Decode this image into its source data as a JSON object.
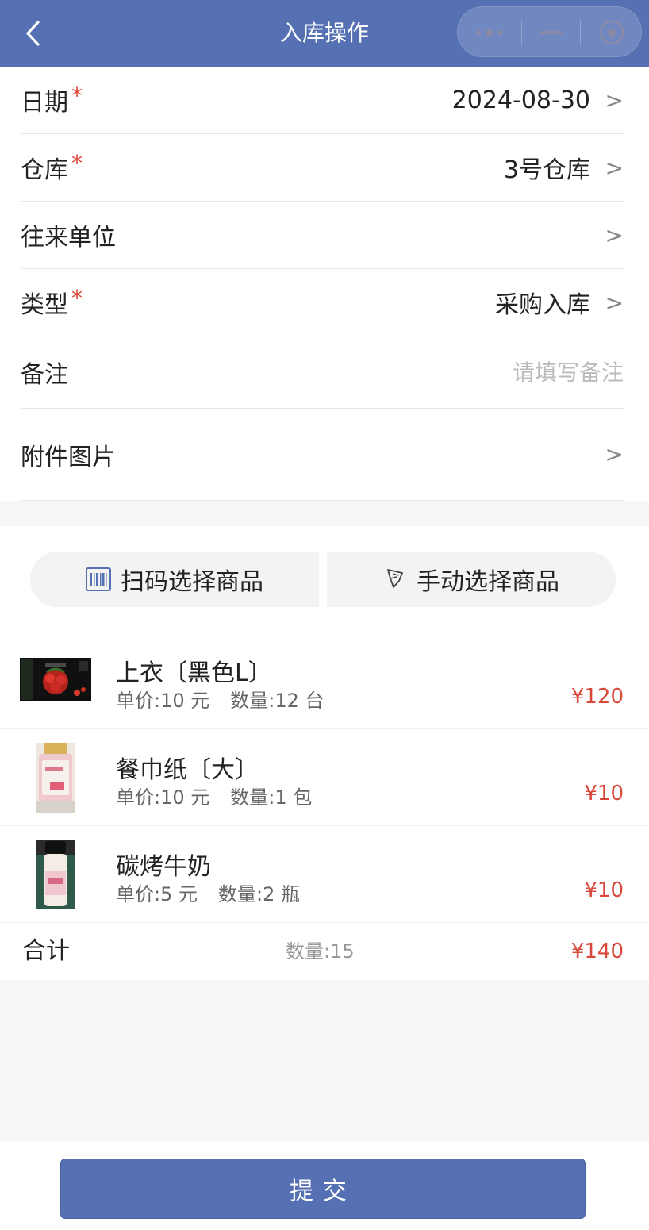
{
  "nav": {
    "title": "入库操作"
  },
  "form": {
    "date": {
      "label": "日期",
      "required": "*",
      "value": "2024-08-30",
      "arrow": ">"
    },
    "warehouse": {
      "label": "仓库",
      "required": "*",
      "value": "3号仓库",
      "arrow": ">"
    },
    "partner": {
      "label": "往来单位",
      "value": "",
      "arrow": ">"
    },
    "type": {
      "label": "类型",
      "required": "*",
      "value": "采购入库",
      "arrow": ">"
    },
    "remark": {
      "label": "备注",
      "value": "",
      "placeholder": "请填写备注"
    },
    "attachment": {
      "label": "附件图片",
      "arrow": ">"
    }
  },
  "actions": {
    "scan_label": "扫码选择商品",
    "manual_label": "手动选择商品"
  },
  "items": [
    {
      "name": "上衣〔黑色L〕",
      "unit_price": "单价:10 元",
      "quantity": "数量:12 台",
      "amount": "¥120"
    },
    {
      "name": "餐巾纸〔大〕",
      "unit_price": "单价:10 元",
      "quantity": "数量:1 包",
      "amount": "¥10"
    },
    {
      "name": "碳烤牛奶",
      "unit_price": "单价:5 元",
      "quantity": "数量:2 瓶",
      "amount": "¥10"
    }
  ],
  "total": {
    "label": "合计",
    "quantity": "数量:15",
    "amount": "¥140"
  },
  "footer": {
    "submit_label": "提交"
  },
  "colors": {
    "primary": "#5570b3",
    "price": "#d9473b",
    "required": "#e0453a"
  }
}
